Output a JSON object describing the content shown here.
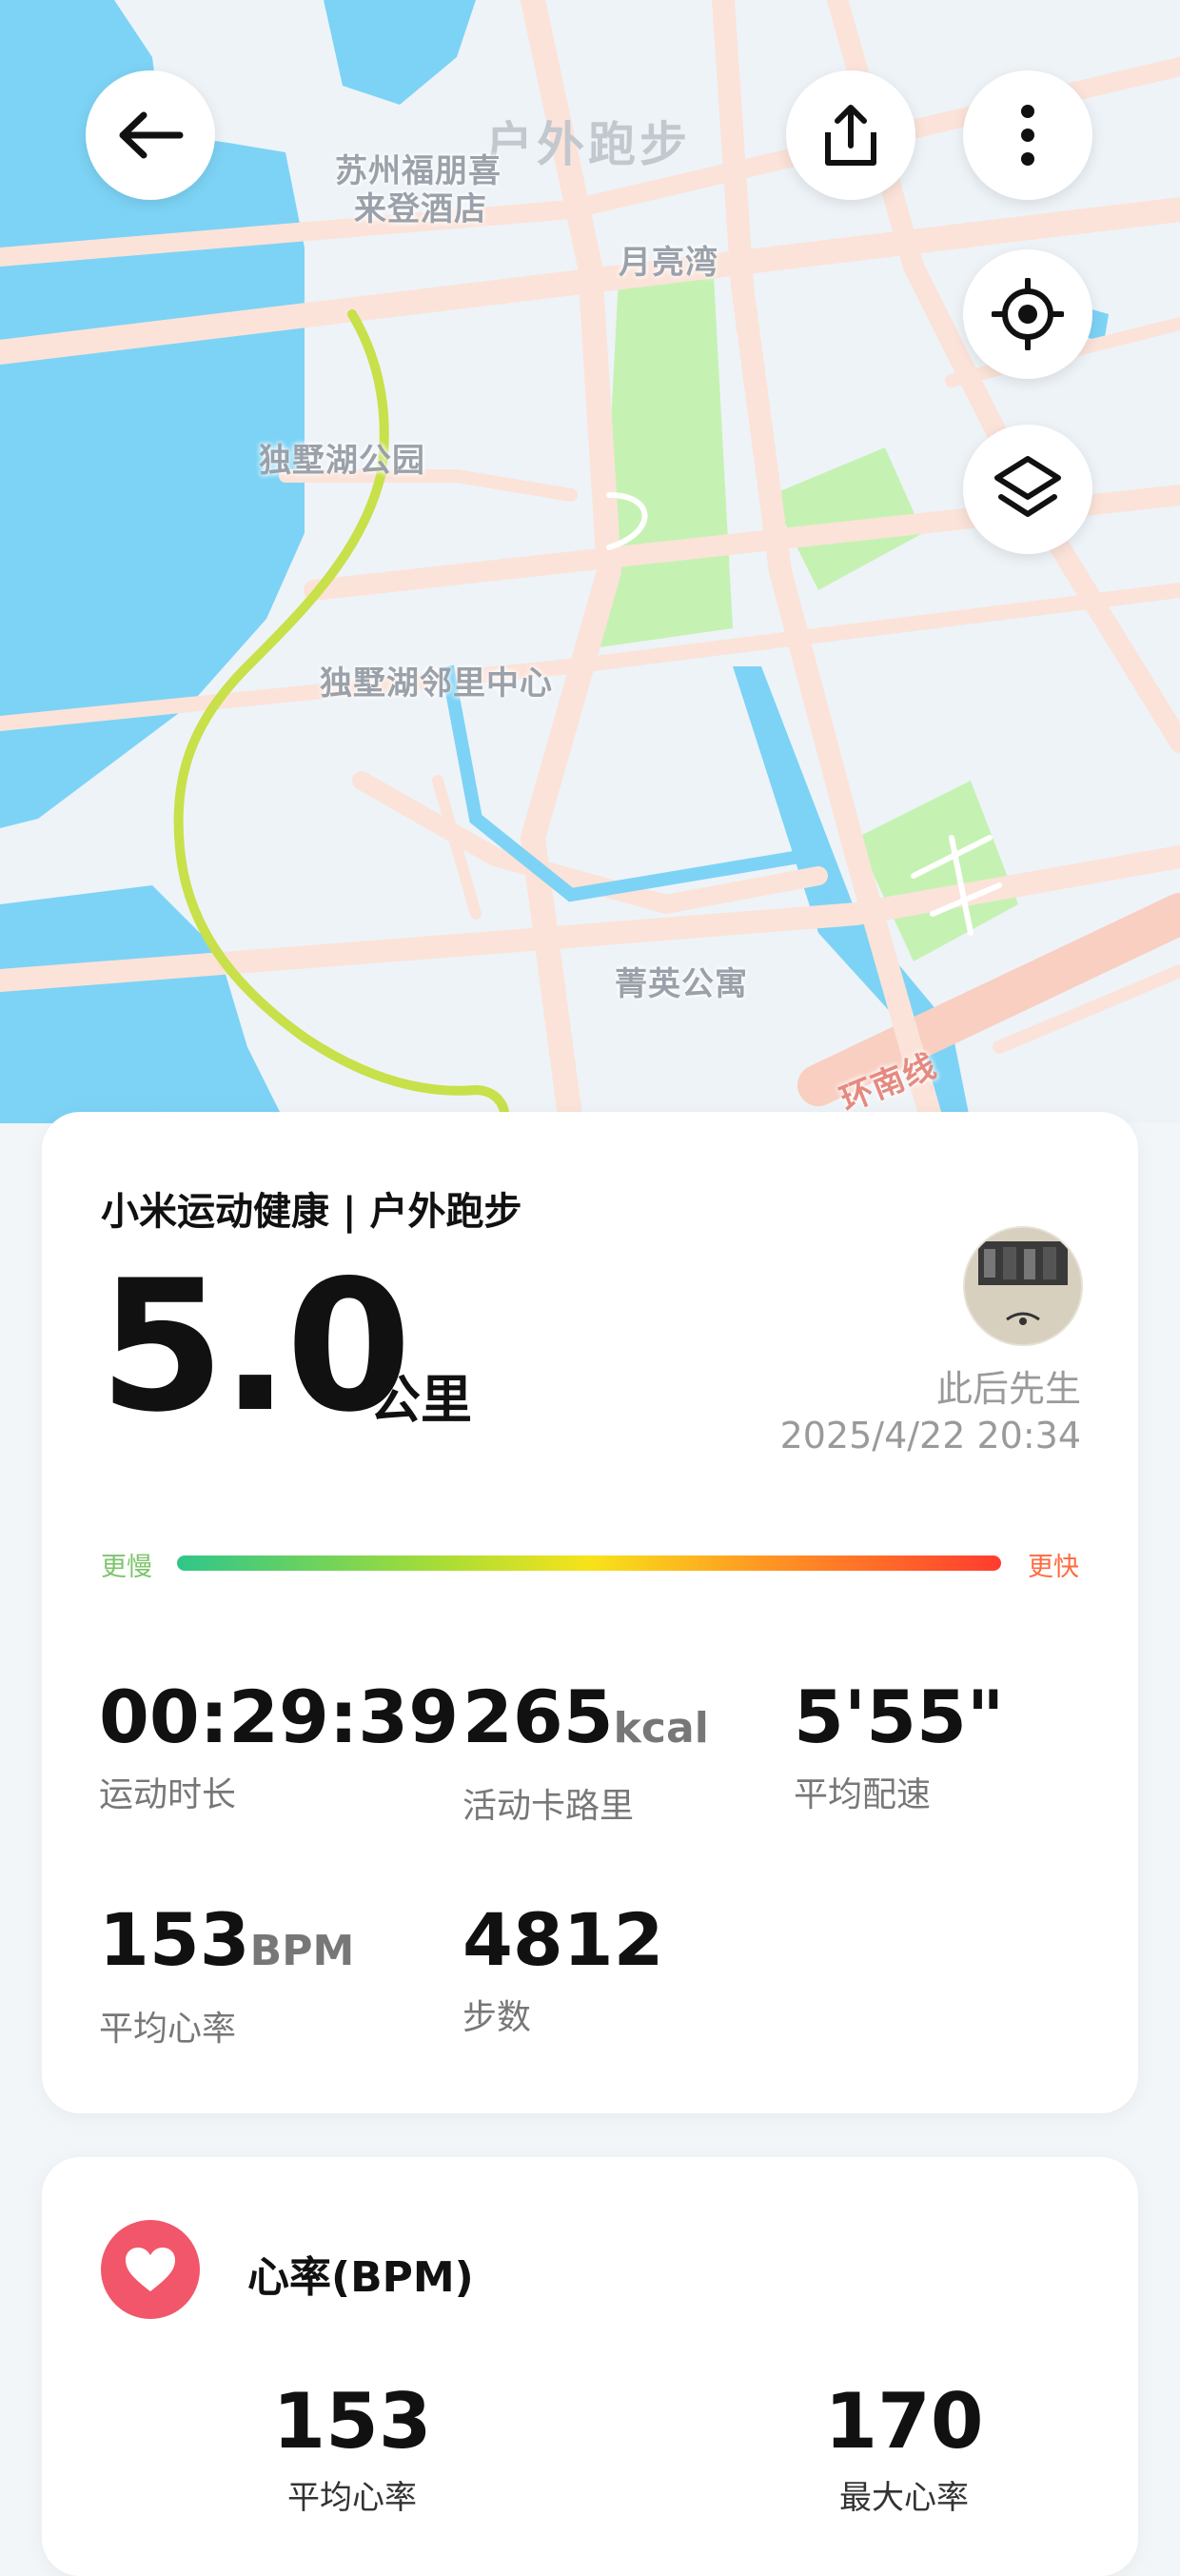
{
  "map": {
    "title": "户外跑步",
    "labels": {
      "hotel_line1": "苏州福朋喜",
      "hotel_line2": "来登酒店",
      "moon_bay": "月亮湾",
      "park": "独墅湖公园",
      "neighborhood": "独墅湖邻里中心",
      "apartment": "菁英公寓",
      "metro": "环南线"
    },
    "controls": {
      "back": "arrow-left-icon",
      "share": "share-icon",
      "more": "more-vertical-icon",
      "locate": "locate-icon",
      "layers": "layers-icon"
    }
  },
  "summary": {
    "brand": "小米运动健康 | 户外跑步",
    "distance": "5.0",
    "distance_unit": "公里",
    "user_name": "此后先生",
    "date_time": "2025/4/22 20:34",
    "pace_legend": {
      "slow": "更慢",
      "fast": "更快"
    },
    "stats": [
      {
        "value": "00:29:39",
        "unit": "",
        "label": "运动时长"
      },
      {
        "value": "265",
        "unit": "kcal",
        "label": "活动卡路里"
      },
      {
        "value": "5'55\"",
        "unit": "",
        "label": "平均配速"
      },
      {
        "value": "153",
        "unit": "BPM",
        "label": "平均心率"
      },
      {
        "value": "4812",
        "unit": "",
        "label": "步数"
      }
    ]
  },
  "heart_rate": {
    "title": "心率(BPM)",
    "avg": {
      "value": "153",
      "label": "平均心率"
    },
    "max": {
      "value": "170",
      "label": "最大心率"
    }
  },
  "colors": {
    "route": "#c8e04a",
    "water": "#7dd3f5",
    "park": "#c5f2b3",
    "road": "#fbe3d9",
    "heart": "#f2566a"
  }
}
